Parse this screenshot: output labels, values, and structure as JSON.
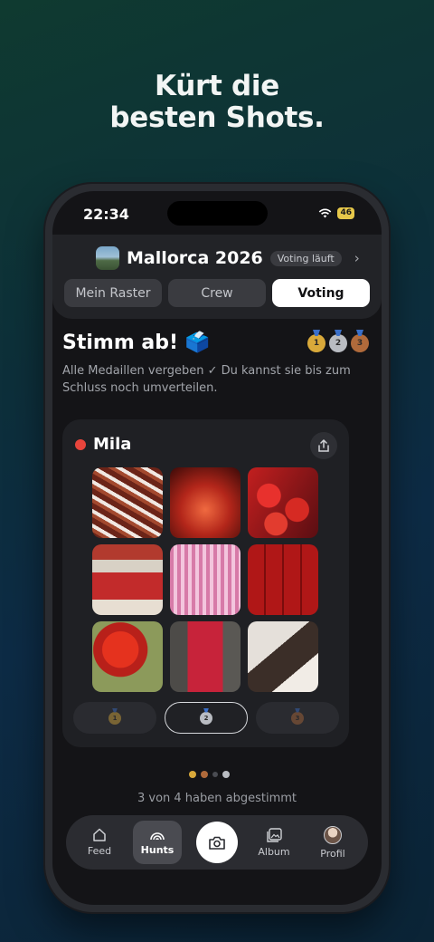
{
  "promo": {
    "line1": "Kürt die",
    "line2": "besten Shots."
  },
  "status_bar": {
    "time": "22:34",
    "battery": "46"
  },
  "trip": {
    "title": "Mallorca 2026",
    "badge": "Voting läuft"
  },
  "tabs": [
    {
      "label": "Mein Raster",
      "active": false
    },
    {
      "label": "Crew",
      "active": false
    },
    {
      "label": "Voting",
      "active": true
    }
  ],
  "voting": {
    "title": "Stimm ab! 🗳️",
    "subtitle": "Alle Medaillen vergeben ✓ Du kannst sie bis zum Schluss noch umverteilen.",
    "medals": [
      "1",
      "2",
      "3"
    ]
  },
  "person": {
    "name": "Mila",
    "photos": [
      "chili-strings",
      "red-car-interior",
      "strawberries-cherries",
      "patos-de-soller-shop",
      "pink-pillows",
      "coca-cola-cans",
      "strawberry-bowl",
      "pepper-garland",
      "woman-sunglasses"
    ],
    "medal_options": [
      {
        "medal": "1",
        "selected": false
      },
      {
        "medal": "2",
        "selected": true
      },
      {
        "medal": "3",
        "selected": false
      }
    ]
  },
  "progress": {
    "text": "3 von 4 haben abgestimmt",
    "voted": 3,
    "total": 4
  },
  "nav": {
    "feed": "Feed",
    "hunts": "Hunts",
    "album": "Album",
    "profile": "Profil"
  },
  "colors": {
    "accent_red": "#e8453c",
    "gold": "#d9a93a",
    "silver": "#b9bcc2",
    "bronze": "#b06a3b"
  }
}
